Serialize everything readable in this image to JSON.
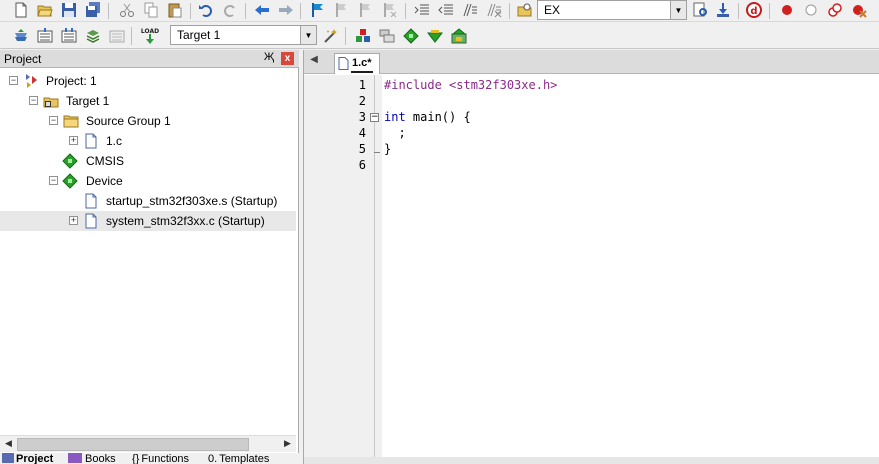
{
  "toolbar1": {
    "target_combo": "EX"
  },
  "toolbar2": {
    "load_label": "LOAD",
    "target_select": "Target 1"
  },
  "project_panel": {
    "title": "Project",
    "pin": "Җ",
    "close": "x",
    "tree": [
      {
        "label": "Project: 1",
        "level": 0,
        "icon": "project-icon",
        "expander": "−"
      },
      {
        "label": "Target 1",
        "level": 1,
        "icon": "target-icon",
        "expander": "−"
      },
      {
        "label": "Source Group 1",
        "level": 2,
        "icon": "folder-icon",
        "expander": "−"
      },
      {
        "label": "1.c",
        "level": 3,
        "icon": "file-icon",
        "expander": "+"
      },
      {
        "label": "CMSIS",
        "level": 2,
        "icon": "component-icon",
        "expander": ""
      },
      {
        "label": "Device",
        "level": 2,
        "icon": "component-icon",
        "expander": "−"
      },
      {
        "label": "startup_stm32f303xe.s (Startup)",
        "level": 3,
        "icon": "file-icon",
        "expander": ""
      },
      {
        "label": "system_stm32f3xx.c (Startup)",
        "level": 3,
        "icon": "file-icon",
        "expander": "+"
      }
    ],
    "bottom_tabs": [
      "Project",
      "Books",
      "Functions",
      "Templates"
    ]
  },
  "editor": {
    "tab_label": "1.c*",
    "lines": [
      {
        "num": "1",
        "parts": [
          {
            "text": "#include <stm32f303xe.h>",
            "cls": "pp"
          }
        ]
      },
      {
        "num": "2",
        "parts": []
      },
      {
        "num": "3",
        "parts": [
          {
            "text": "int",
            "cls": "kw"
          },
          {
            "text": " main() {",
            "cls": ""
          }
        ]
      },
      {
        "num": "4",
        "parts": [
          {
            "text": "  ;",
            "cls": ""
          }
        ]
      },
      {
        "num": "5",
        "parts": [
          {
            "text": "}",
            "cls": ""
          }
        ]
      },
      {
        "num": "6",
        "parts": []
      }
    ]
  },
  "colors": {
    "keyword": "#0000c8",
    "preprocessor": "#8a2a8a",
    "close_button": "#d9463a"
  }
}
